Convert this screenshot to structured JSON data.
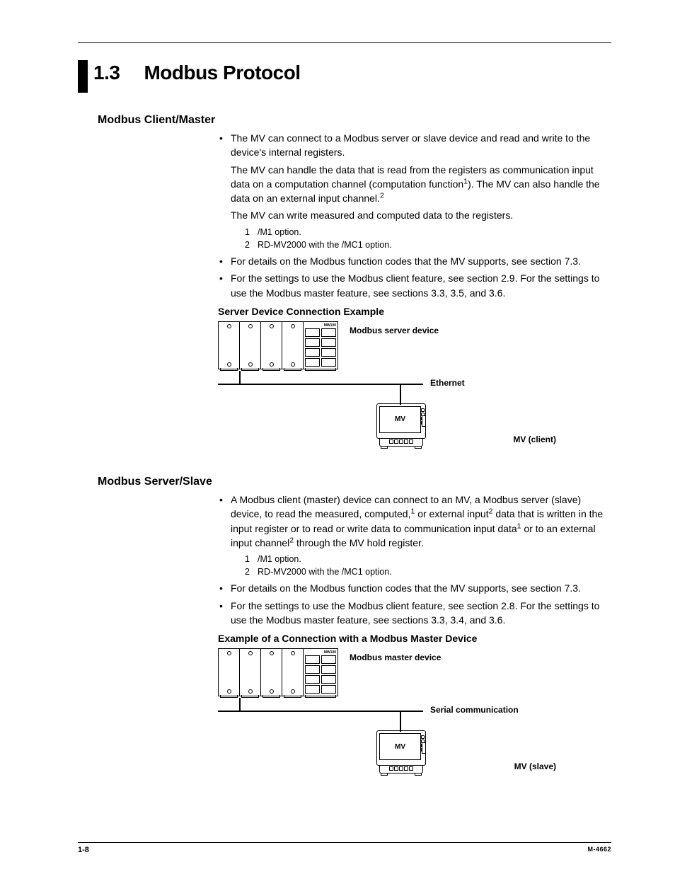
{
  "chapter": {
    "number": "1.3",
    "title": "Modbus Protocol"
  },
  "section1": {
    "heading": "Modbus Client/Master",
    "bullets": {
      "b1_p1": "The MV can connect to a Modbus server or slave device and read and write to the device's internal registers.",
      "b1_p2_a": "The MV can handle the data that is read from the registers as communication input data on a computation channel (computation function",
      "b1_p2_b": "). The MV can also handle the data on an external input channel.",
      "b1_p3": "The MV can write measured and computed data to the registers.",
      "b2": "For details on the Modbus function codes that the MV supports, see section 7.3.",
      "b3": "For the settings to use the Modbus client feature, see section 2.9. For the settings to use the Modbus master feature, see sections 3.3, 3.5, and 3.6."
    },
    "footnotes": {
      "f1_num": "1",
      "f1_text": "/M1 option.",
      "f2_num": "2",
      "f2_text": "RD-MV2000 with the /MC1 option."
    },
    "sub_heading": "Server Device Connection Example",
    "diagram": {
      "rack_label": "Modbus server device",
      "cpu_label": "MW100",
      "net_label": "Ethernet",
      "mv_text": "MV",
      "mv_label": "MV (client)"
    }
  },
  "section2": {
    "heading": "Modbus Server/Slave",
    "bullets": {
      "b1_a": "A Modbus client (master) device can connect to an MV, a Modbus server (slave) device, to read the measured, computed,",
      "b1_b": " or external input",
      "b1_c": " data that is written in the input register or to read or write data to communication input data",
      "b1_d": " or to an external input channel",
      "b1_e": " through the MV hold register.",
      "b2": "For details on the Modbus function codes that the MV supports, see section 7.3.",
      "b3": "For the settings to use the Modbus client feature, see section 2.8. For the settings to use the Modbus master feature, see sections 3.3, 3.4, and 3.6."
    },
    "footnotes": {
      "f1_num": "1",
      "f1_text": "/M1 option.",
      "f2_num": "2",
      "f2_text": "RD-MV2000 with the /MC1 option."
    },
    "sub_heading": "Example of a Connection with a Modbus Master Device",
    "diagram": {
      "rack_label": "Modbus master device",
      "cpu_label": "MW100",
      "net_label": "Serial communication",
      "mv_text": "MV",
      "mv_label": "MV (slave)"
    }
  },
  "sup": {
    "one": "1",
    "two": "2"
  },
  "footer": {
    "page_num": "1-8",
    "doc_id": "M-4662"
  }
}
